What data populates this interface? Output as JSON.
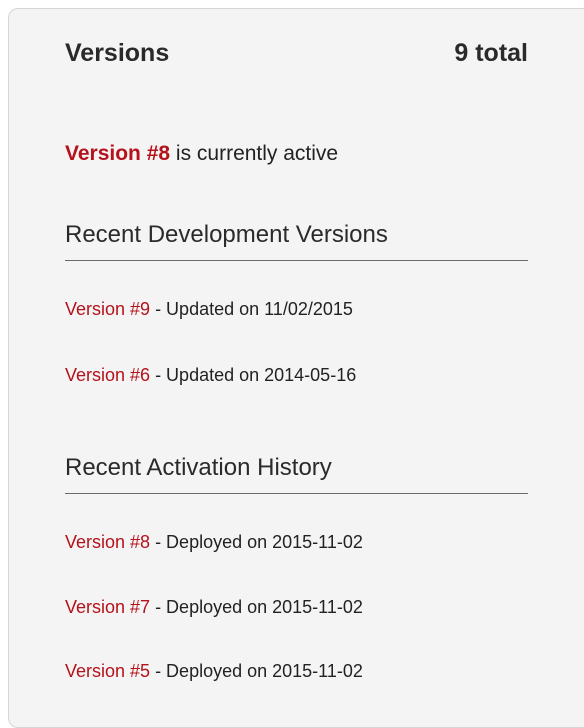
{
  "header": {
    "title": "Versions",
    "total": "9 total"
  },
  "active": {
    "version_label": "Version #8",
    "suffix": " is currently active"
  },
  "development": {
    "title": "Recent Development Versions",
    "items": [
      {
        "version": "Version #9",
        "detail": " - Updated on 11/02/2015"
      },
      {
        "version": "Version #6",
        "detail": " - Updated on 2014-05-16"
      }
    ]
  },
  "activation": {
    "title": "Recent Activation History",
    "items": [
      {
        "version": "Version #8",
        "detail": " - Deployed on 2015-11-02"
      },
      {
        "version": "Version #7",
        "detail": " - Deployed on 2015-11-02"
      },
      {
        "version": "Version #5",
        "detail": " - Deployed on 2015-11-02"
      }
    ]
  },
  "colors": {
    "accent": "#b5121b",
    "panel_background": "#f4f4f4"
  }
}
